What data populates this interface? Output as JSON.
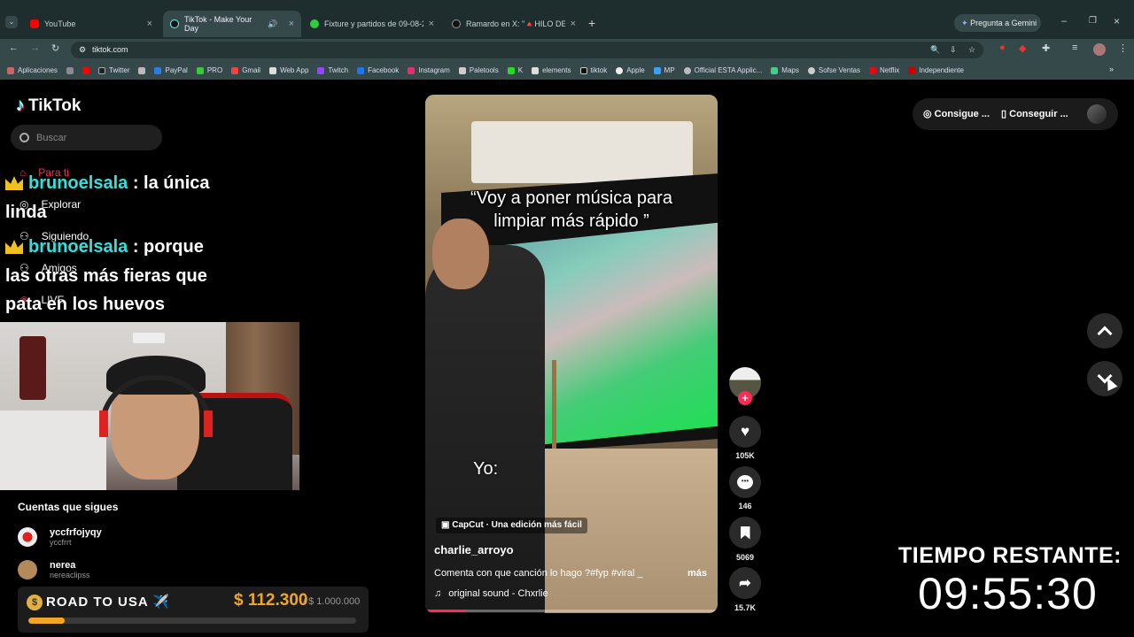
{
  "browser": {
    "tabs": [
      {
        "label": "YouTube",
        "color": "#ff0000"
      },
      {
        "label": "TikTok - Make Your Day",
        "color": "#111111"
      },
      {
        "label": "Fixture y partidos de 09-08-20:",
        "color": "#2ecc40"
      },
      {
        "label": "Ramardo en X: \"🔺HILO DEFINI",
        "color": "#111111"
      }
    ],
    "gemini_label": "Pregunta a Gemini",
    "url": "tiktok.com",
    "bookmarks": [
      "Aplicaciones",
      "Twitter",
      "PayPal",
      "PRO",
      "Gmail",
      "Web App",
      "Twitch",
      "Facebook",
      "Instagram",
      "Paletools",
      "K",
      "elements",
      "tiktok",
      "Apple",
      "MP",
      "Official ESTA Applic...",
      "Maps",
      "Sofse Ventas",
      "Netflix",
      "Independiente"
    ]
  },
  "tiktok": {
    "logo": "TikTok",
    "search_placeholder": "Buscar",
    "nav": [
      "Para ti",
      "Explorar",
      "Siguiendo",
      "Amigos",
      "LIVE"
    ],
    "following_title": "Cuentas que sigues",
    "following": [
      {
        "name": "yccfrfojyqy",
        "handle": "yccfrrt"
      },
      {
        "name": "nerea",
        "handle": "nereaclipss"
      }
    ],
    "top_buttons": [
      "Consigue ...",
      "Conseguir ..."
    ],
    "video": {
      "caption_top_1": "“Voy a poner música para",
      "caption_top_2": "limpiar más rápido ”",
      "caption_yo": "Yo:",
      "capcut": "CapCut · Una edición más fácil",
      "author": "charlie_arroyo",
      "description": "Comenta con que canción lo hago ?#fyp #viral _",
      "more": "más",
      "sound": "original sound - Chxrlie"
    },
    "actions": {
      "likes": "105K",
      "comments": "146",
      "saves": "5069",
      "shares": "15.7K"
    }
  },
  "stream": {
    "chat": [
      {
        "user": "brunoelsala",
        "text_1": ": la única",
        "text_2": "linda"
      },
      {
        "user": "brunoelsala",
        "text_1": ": porque",
        "text_2": "las otras más fieras que",
        "text_3": "pata en los huevos"
      }
    ],
    "road_label": "ROAD TO USA ✈️",
    "road_amount": "$ 112.300",
    "road_goal": "/ $ 1.000.000",
    "road_progress": 0.11,
    "timer_label": "TIEMPO RESTANTE:",
    "timer_value": "09:55:30"
  }
}
